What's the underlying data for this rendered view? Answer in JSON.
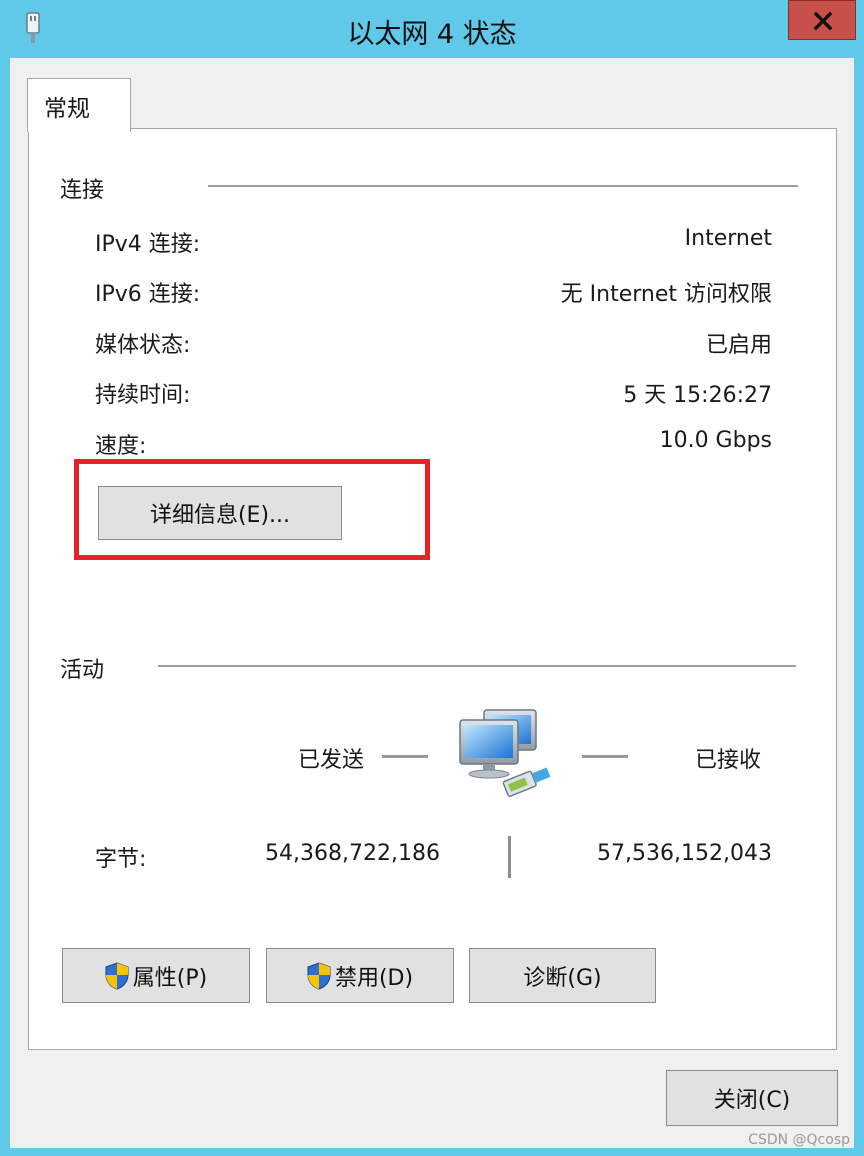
{
  "window": {
    "title": "以太网 4 状态"
  },
  "tabs": [
    {
      "label": "常规"
    }
  ],
  "connection": {
    "header": "连接",
    "rows": [
      {
        "label": "IPv4 连接:",
        "value": "Internet"
      },
      {
        "label": "IPv6 连接:",
        "value": "无 Internet 访问权限"
      },
      {
        "label": "媒体状态:",
        "value": "已启用"
      },
      {
        "label": "持续时间:",
        "value": "5 天 15:26:27"
      },
      {
        "label": "速度:",
        "value": "10.0 Gbps"
      }
    ],
    "details_button": "详细信息(E)..."
  },
  "activity": {
    "header": "活动",
    "sent_label": "已发送",
    "received_label": "已接收",
    "bytes_label": "字节:",
    "bytes_sent": "54,368,722,186",
    "bytes_received": "57,536,152,043"
  },
  "buttons": {
    "properties": "属性(P)",
    "disable": "禁用(D)",
    "diagnose": "诊断(G)",
    "close": "关闭(C)"
  },
  "watermark": "CSDN @Qcosp",
  "colors": {
    "title_bar": "#60c8e8",
    "close_button": "#c7504b",
    "highlight": "#e8202a"
  },
  "icons": [
    "network-adapter-icon",
    "close-icon",
    "network-computers-icon",
    "uac-shield-icon"
  ]
}
